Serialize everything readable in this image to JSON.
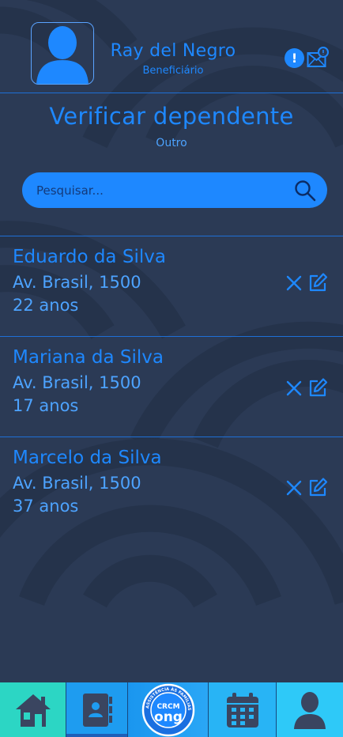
{
  "header": {
    "user_name": "Ray del Negro",
    "user_role": "Beneficiário",
    "icons": [
      "avatar-icon",
      "alert-icon",
      "mail-icon"
    ]
  },
  "page": {
    "title": "Verificar dependente",
    "subtitle": "Outro"
  },
  "search": {
    "placeholder": "Pesquisar...",
    "value": ""
  },
  "dependents": [
    {
      "name": "Eduardo da Silva",
      "address": "Av. Brasil, 1500",
      "age": "22 anos"
    },
    {
      "name": "Mariana da Silva",
      "address": "Av. Brasil, 1500",
      "age": "17 anos"
    },
    {
      "name": "Marcelo da Silva",
      "address": "Av. Brasil, 1500",
      "age": "37 anos"
    }
  ],
  "bottom_nav": {
    "items": [
      "home-icon",
      "contacts-icon",
      "crcm-ong-logo",
      "calendar-icon",
      "profile-icon"
    ],
    "logo_text": "CRCM",
    "logo_sub": "ong",
    "logo_ring": "ASSISTÊNCIA ÀS FAMÍLIAS"
  },
  "colors": {
    "background": "#2b3a55",
    "accent": "#1e88ff",
    "nav_gradient": [
      "#2cd6c4",
      "#1e9cf0",
      "#28b4f5",
      "#2ec9f8"
    ]
  }
}
